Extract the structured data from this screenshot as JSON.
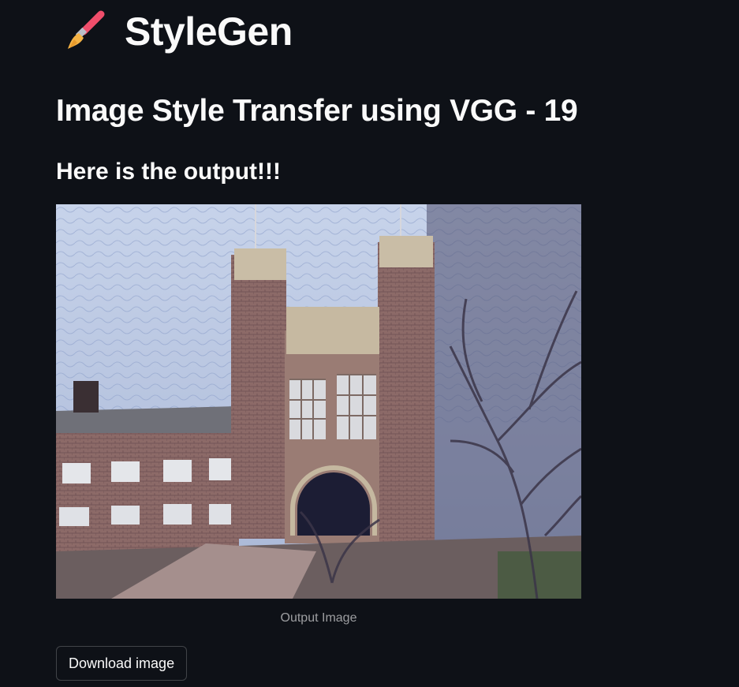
{
  "brand": {
    "icon": "paintbrush-icon",
    "title": "StyleGen"
  },
  "main": {
    "title": "Image Style Transfer using VGG - 19",
    "subheading": "Here is the output!!!",
    "output": {
      "caption": "Output Image"
    },
    "download_label": "Download image"
  },
  "colors": {
    "background": "#0e1117",
    "text": "#fafafa",
    "brush_handle": "#f04e6b",
    "brush_bristles": "#f4b345"
  }
}
